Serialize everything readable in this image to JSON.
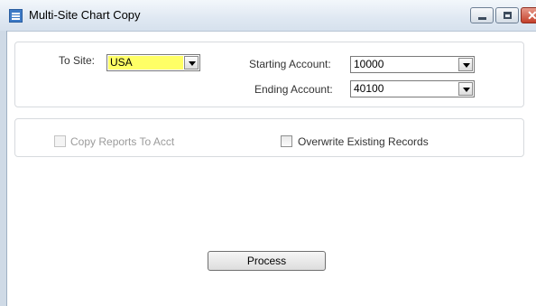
{
  "window": {
    "title": "Multi-Site Chart Copy",
    "accent": "#3d7ac6",
    "close_glyph": "✕",
    "icons": [
      "app-icon",
      "minimize-icon",
      "maximize-icon",
      "close-icon"
    ]
  },
  "site_section": {
    "to_site_label": "To Site:",
    "to_site_value": "USA",
    "to_site_highlight": "#ffff66",
    "starting_account_label": "Starting Account:",
    "starting_account_value": "10000",
    "ending_account_label": "Ending Account:",
    "ending_account_value": "40100"
  },
  "options": {
    "copy_reports_label": "Copy Reports To Acct",
    "copy_reports_checked": false,
    "copy_reports_enabled": false,
    "overwrite_label": "Overwrite Existing Records",
    "overwrite_checked": false
  },
  "actions": {
    "process_label": "Process"
  }
}
